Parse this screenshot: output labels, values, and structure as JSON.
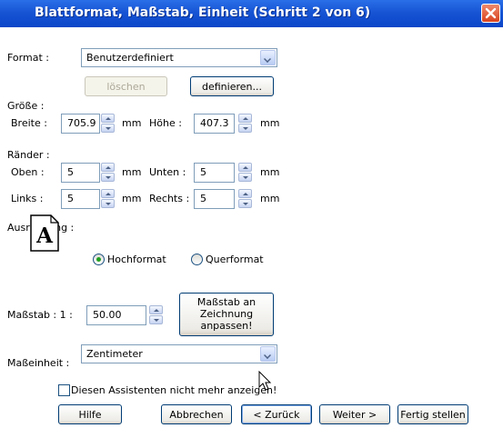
{
  "window": {
    "title": "Blattformat, Maßstab, Einheit (Schritt 2 von 6)",
    "close_icon": "close-icon"
  },
  "format": {
    "label": "Format :",
    "value": "Benutzerdefiniert",
    "delete_button": "löschen",
    "define_button": "definieren..."
  },
  "size": {
    "section": "Größe :",
    "width_label": "Breite :",
    "width_value": "705.9",
    "width_unit": "mm",
    "height_label": "Höhe :",
    "height_value": "407.3",
    "height_unit": "mm"
  },
  "margins": {
    "section": "Ränder :",
    "top_label": "Oben :",
    "top_value": "5",
    "top_unit": "mm",
    "bottom_label": "Unten :",
    "bottom_value": "5",
    "bottom_unit": "mm",
    "left_label": "Links :",
    "left_value": "5",
    "left_unit": "mm",
    "right_label": "Rechts :",
    "right_value": "5",
    "right_unit": "mm"
  },
  "orientation": {
    "section": "Ausrichtung :",
    "icon_letter": "A",
    "portrait": "Hochformat",
    "landscape": "Querformat",
    "selected": "portrait"
  },
  "scale": {
    "label": "Maßstab : 1 :",
    "value": "50.00",
    "fit_button": [
      "Maßstab an",
      "Zeichnung",
      "anpassen!"
    ]
  },
  "unit": {
    "label": "Maßeinheit :",
    "value": "Zentimeter"
  },
  "dont_show": {
    "label": "Diesen Assistenten nicht mehr anzeigen!",
    "checked": false
  },
  "footer": {
    "help": "Hilfe",
    "cancel": "Abbrechen",
    "back": "< Zurück",
    "next": "Weiter >",
    "finish": "Fertig stellen"
  }
}
